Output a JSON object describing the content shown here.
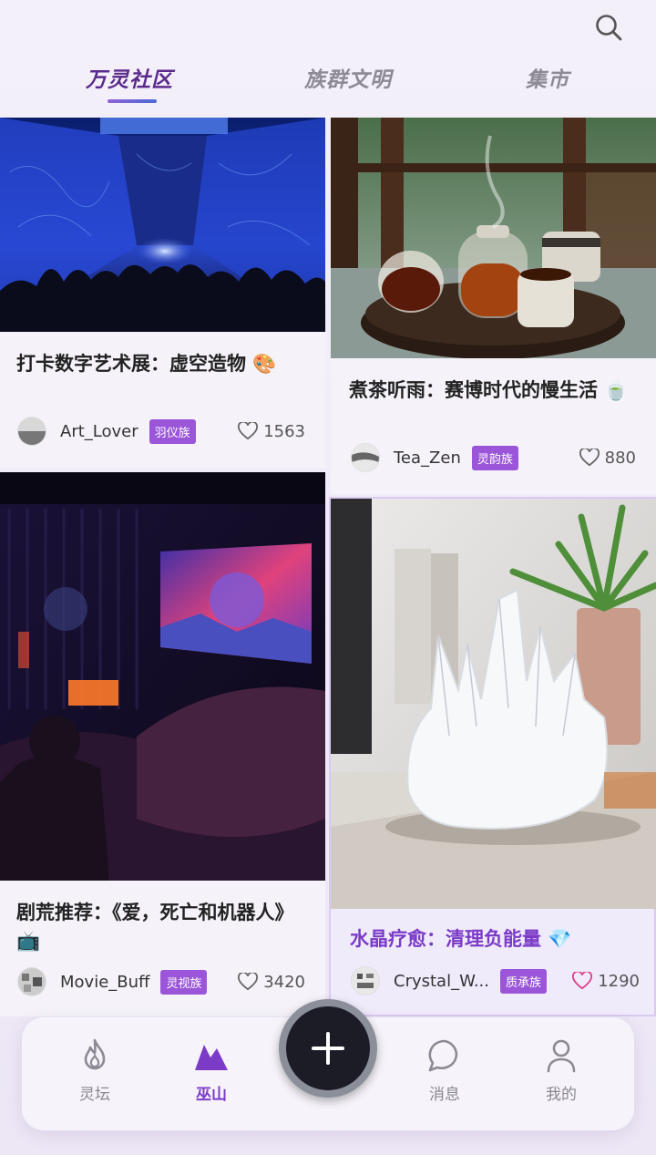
{
  "tabs": [
    {
      "label": "万灵社区",
      "active": true
    },
    {
      "label": "族群文明",
      "active": false
    },
    {
      "label": "集市",
      "active": false
    }
  ],
  "posts": [
    {
      "title": "打卡数字艺术展：虚空造物 🎨",
      "username": "Art_Lover",
      "tribe": "羽仪族",
      "likes": "1563",
      "liked": false,
      "image": "digital-art-exhibition"
    },
    {
      "title": "煮茶听雨：赛博时代的慢生活 🍵",
      "username": "Tea_Zen",
      "tribe": "灵韵族",
      "likes": "880",
      "liked": false,
      "image": "tea-set"
    },
    {
      "title": "剧荒推荐：《爱，死亡和机器人》 📺",
      "username": "Movie_Buff",
      "tribe": "灵视族",
      "likes": "3420",
      "liked": false,
      "image": "home-theater"
    },
    {
      "title": "水晶疗愈：清理负能量 💎",
      "username": "Crystal_W...",
      "tribe": "质承族",
      "likes": "1290",
      "liked": true,
      "image": "quartz-crystal"
    }
  ],
  "nav": [
    {
      "label": "灵坛",
      "icon": "flame-icon",
      "active": false
    },
    {
      "label": "巫山",
      "icon": "mountain-icon",
      "active": true
    },
    {
      "label": "消息",
      "icon": "chat-bubble-icon",
      "active": false
    },
    {
      "label": "我的",
      "icon": "user-icon",
      "active": false
    }
  ],
  "fab": {
    "icon": "plus-icon"
  },
  "colors": {
    "accent": "#7b3bc7",
    "badge": "#9a55d9",
    "fab": "#1b1c26"
  }
}
